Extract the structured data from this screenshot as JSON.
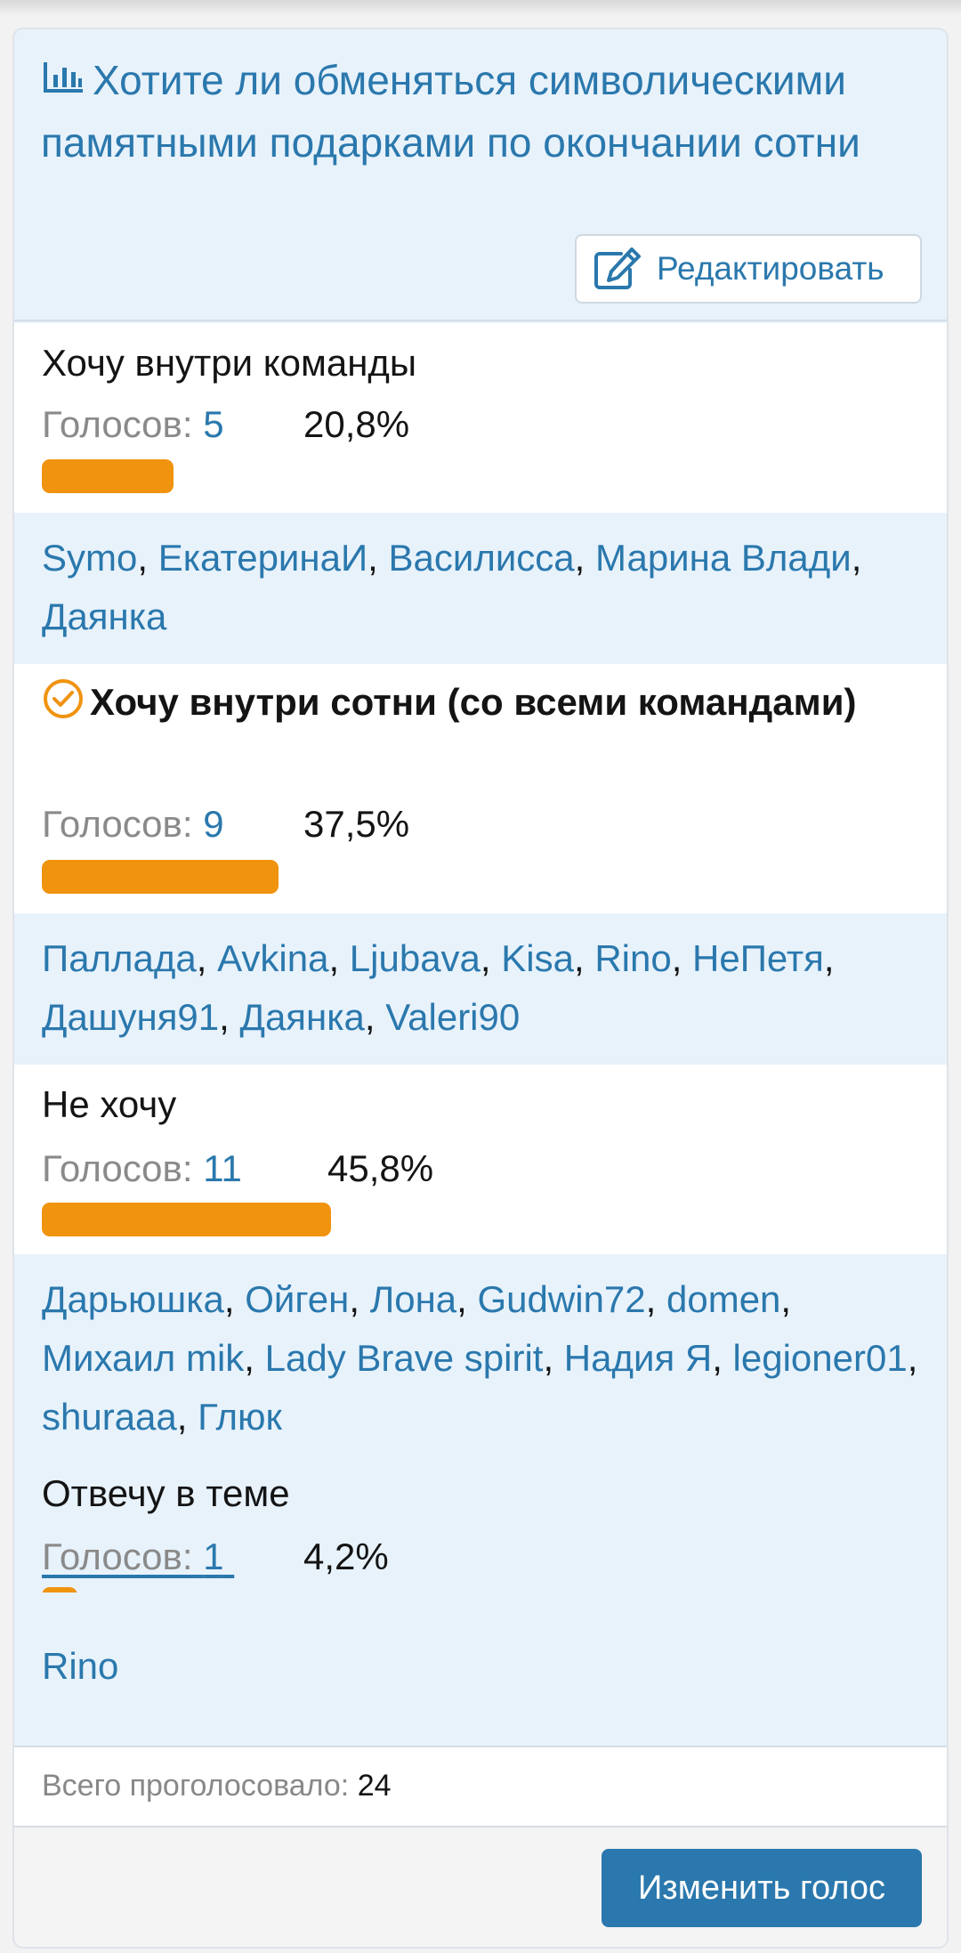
{
  "poll": {
    "title": "Хотите ли обменяться символическими памятными подарками по окончании сотни",
    "edit_label": "Редактировать",
    "votes_label": "Голосов:",
    "options": [
      {
        "label": "Хочу внутри команды",
        "votes": "5",
        "percent": "20,8%",
        "fraction": 0.208,
        "selected": false,
        "voters": [
          "Symo",
          "ЕкатеринаИ",
          "Василисса",
          "Марина Влади",
          "Даянка"
        ]
      },
      {
        "label": "Хочу внутри сотни (со всеми командами)",
        "votes": "9",
        "percent": "37,5%",
        "fraction": 0.375,
        "selected": true,
        "voters": [
          "Паллада",
          "Avkina",
          "Ljubava",
          "Kisa",
          "Rino",
          "НеПетя",
          "Дашуня91",
          "Даянка",
          "Valeri90"
        ]
      },
      {
        "label": "Не хочу",
        "votes": "11",
        "percent": "45,8%",
        "fraction": 0.458,
        "selected": false,
        "voters": [
          "Дарьюшка",
          "Ойген",
          "Лона",
          "Gudwin72",
          "domen",
          "Михаил mik",
          "Lady Brave spirit",
          "Надия Я",
          "legioner01",
          "shuraaa",
          "Глюк"
        ]
      },
      {
        "label": "Отвечу в теме",
        "votes": "1",
        "percent": "4,2%",
        "fraction": 0.042,
        "selected": false,
        "voters": [
          "Rino"
        ]
      }
    ],
    "total_label": "Всего проголосовало:",
    "total_value": "24",
    "change_vote_label": "Изменить голос"
  },
  "colors": {
    "accent": "#2a78ad",
    "bar": "#f0930f",
    "header_bg": "#e8f2fb"
  },
  "icons": [
    "bar-chart-icon",
    "edit-icon",
    "check-circle-icon"
  ]
}
